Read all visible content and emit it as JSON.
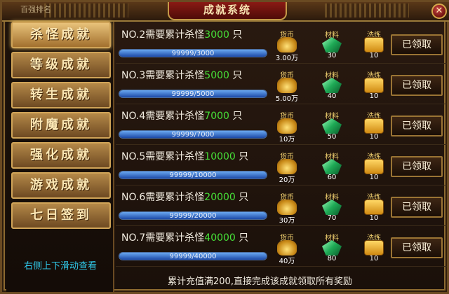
{
  "window": {
    "title": "成就系统",
    "corner_text": "百强排名",
    "close_glyph": "✕"
  },
  "sidebar": {
    "items": [
      {
        "label": "杀怪成就",
        "active": true,
        "badge": false
      },
      {
        "label": "等级成就",
        "active": false,
        "badge": true
      },
      {
        "label": "转生成就",
        "active": false,
        "badge": true
      },
      {
        "label": "附魔成就",
        "active": false,
        "badge": false
      },
      {
        "label": "强化成就",
        "active": false,
        "badge": false
      },
      {
        "label": "游戏成就",
        "active": false,
        "badge": false
      },
      {
        "label": "七日签到",
        "active": false,
        "badge": false
      }
    ],
    "hint": "右侧上下滑动查看"
  },
  "reward_labels": {
    "gold": "货币",
    "material": "材料",
    "wash": "洗炼"
  },
  "rows": [
    {
      "prefix": "NO.2需要累计杀怪",
      "target": "3000",
      "suffix": "只",
      "progress": "99999/3000",
      "progress_ratio": 1.0,
      "gold": "3.00万",
      "material": "30",
      "wash": "10",
      "claim_label": "已领取"
    },
    {
      "prefix": "NO.3需要累计杀怪",
      "target": "5000",
      "suffix": "只",
      "progress": "99999/5000",
      "progress_ratio": 1.0,
      "gold": "5.00万",
      "material": "40",
      "wash": "10",
      "claim_label": "已领取"
    },
    {
      "prefix": "NO.4需要累计杀怪",
      "target": "7000",
      "suffix": "只",
      "progress": "99999/7000",
      "progress_ratio": 1.0,
      "gold": "10万",
      "material": "50",
      "wash": "10",
      "claim_label": "已领取"
    },
    {
      "prefix": "NO.5需要累计杀怪",
      "target": "10000",
      "suffix": "只",
      "progress": "99999/10000",
      "progress_ratio": 1.0,
      "gold": "20万",
      "material": "60",
      "wash": "10",
      "claim_label": "已领取"
    },
    {
      "prefix": "NO.6需要累计杀怪",
      "target": "20000",
      "suffix": "只",
      "progress": "99999/20000",
      "progress_ratio": 1.0,
      "gold": "30万",
      "material": "70",
      "wash": "10",
      "claim_label": "已领取"
    },
    {
      "prefix": "NO.7需要累计杀怪",
      "target": "40000",
      "suffix": "只",
      "progress": "99999/40000",
      "progress_ratio": 1.0,
      "gold": "40万",
      "material": "80",
      "wash": "10",
      "claim_label": "已领取"
    }
  ],
  "footer": "累计充值满200,直接完成该成就领取所有奖励",
  "colors": {
    "target_green": "#46e038",
    "hint_cyan": "#30c8e8",
    "gold_label": "#f0d070"
  }
}
